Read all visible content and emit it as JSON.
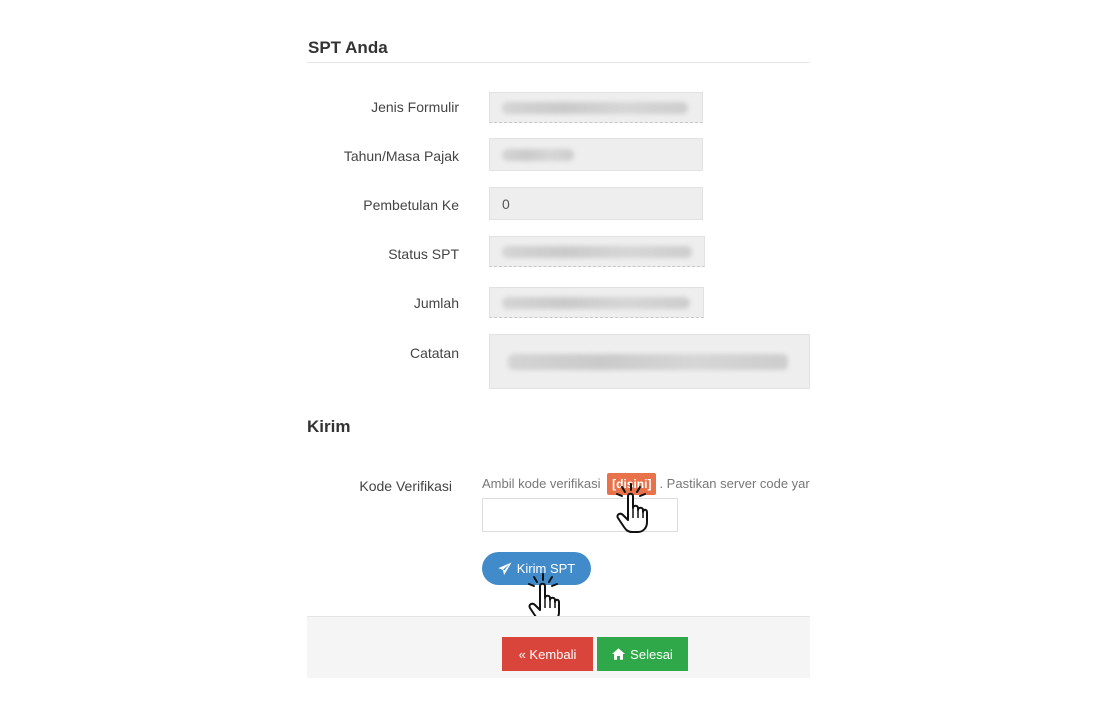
{
  "spt_section": {
    "title": "SPT Anda",
    "fields": [
      {
        "label": "Jenis Formulir",
        "value": ""
      },
      {
        "label": "Tahun/Masa Pajak",
        "value": ""
      },
      {
        "label": "Pembetulan Ke",
        "value": "0"
      },
      {
        "label": "Status SPT",
        "value": ""
      },
      {
        "label": "Jumlah",
        "value": ""
      },
      {
        "label": "Catatan",
        "value": ""
      }
    ]
  },
  "kirim_section": {
    "title": "Kirim",
    "verification_label": "Kode Verifikasi",
    "hint_prefix": "Ambil kode verifikasi",
    "hint_link": "[disini]",
    "hint_suffix": ". Pastikan server code yar",
    "input_value": "",
    "send_button_label": "Kirim SPT"
  },
  "footer": {
    "back_label": "« Kembali",
    "done_label": "Selesai"
  },
  "colors": {
    "primary": "#428bca",
    "danger": "#d9453a",
    "success": "#2fa84a",
    "badge": "#e8724a"
  }
}
